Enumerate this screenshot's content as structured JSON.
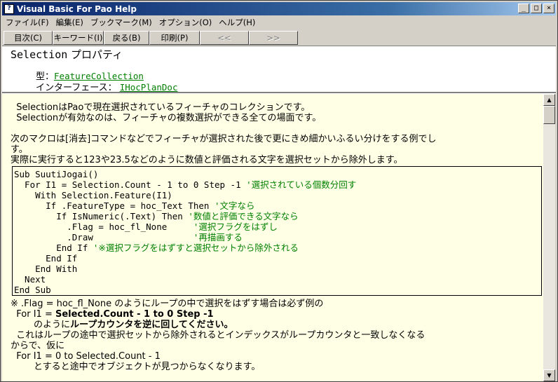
{
  "window": {
    "title": "Visual Basic For Pao Help",
    "title_icon": "help-book-icon",
    "controls": {
      "minimize": "_",
      "maximize": "□",
      "close": "×"
    }
  },
  "menu": [
    "ファイル(F)",
    "編集(E)",
    "ブックマーク(M)",
    "オプション(O)",
    "ヘルプ(H)"
  ],
  "toolbar": {
    "contents": "目次(C)",
    "keyword": "キーワード(I)",
    "back": "戻る(B)",
    "print": "印刷(P)",
    "prev": "<<",
    "next": ">>"
  },
  "header": {
    "prop_name": "Selection",
    "prop_kind": " プロパティ",
    "type_label": "型：",
    "type_value": "FeatureCollection",
    "iface_label": "インターフェース：  ",
    "iface_value": "IHocPlanDoc"
  },
  "body": {
    "p1_l1": "  SelectionはPaoで現在選択されているフィーチャのコレクションです。",
    "p1_l2": "  Selectionが有効なのは、フィーチャの複数選択ができる全ての場面です。",
    "p2_l1": "次のマクロは[消去]コマンドなどでフィーチャが選択された後で更にきめ細かいふるい分けをする例でし",
    "p2_l2": "す。",
    "p2_l3": "実際に実行すると123や23.5などのように数値と評価される文字を選択セットから除外します。",
    "code": {
      "l1": "Sub SuutiJogai()",
      "l2a": "  For I1 = Selection.Count - 1 to 0 Step -1 ",
      "l2c": "'選択されている個数分回す",
      "l3": "    With Selection.Feature(I1)",
      "l4a": "      If .FeatureType = hoc_Text Then ",
      "l4c": "'文字なら",
      "l5a": "        If IsNumeric(.Text) Then ",
      "l5c": "'数値と評価できる文字なら",
      "l6a": "          .Flag = hoc_fl_None     ",
      "l6c": "'選択フラグをはずし",
      "l7a": "          .Draw                   ",
      "l7c": "'再描画する",
      "l8a": "        End If ",
      "l8c": "'※選択フラグをはずすと選択セットから除外される",
      "l9": "      End If",
      "l10": "    End With",
      "l11": "  Next",
      "l12": "End Sub"
    },
    "n1": "※ .Flag = hoc_fl_None のようにループの中で選択をはずす場合は必ず例の",
    "n2a": "  For I1 = ",
    "n2b": "Selected.Count - 1 to 0 Step -1",
    "n3a": "        のように",
    "n3b": "ループカウンタを逆に回してください。",
    "n4": "  これはループの途中で選択セットから除外されるとインデックスがループカウンタと一致しなくなる",
    "n5": "からで、仮に",
    "n6": "  For I1 = 0 to Selected.Count - 1",
    "n7": "        とすると途中でオブジェクトが見つからなくなります。"
  },
  "colors": {
    "content_bg": "#ffffe6",
    "comment": "#008000",
    "link": "#008000",
    "title_bar": "#0a246a"
  }
}
